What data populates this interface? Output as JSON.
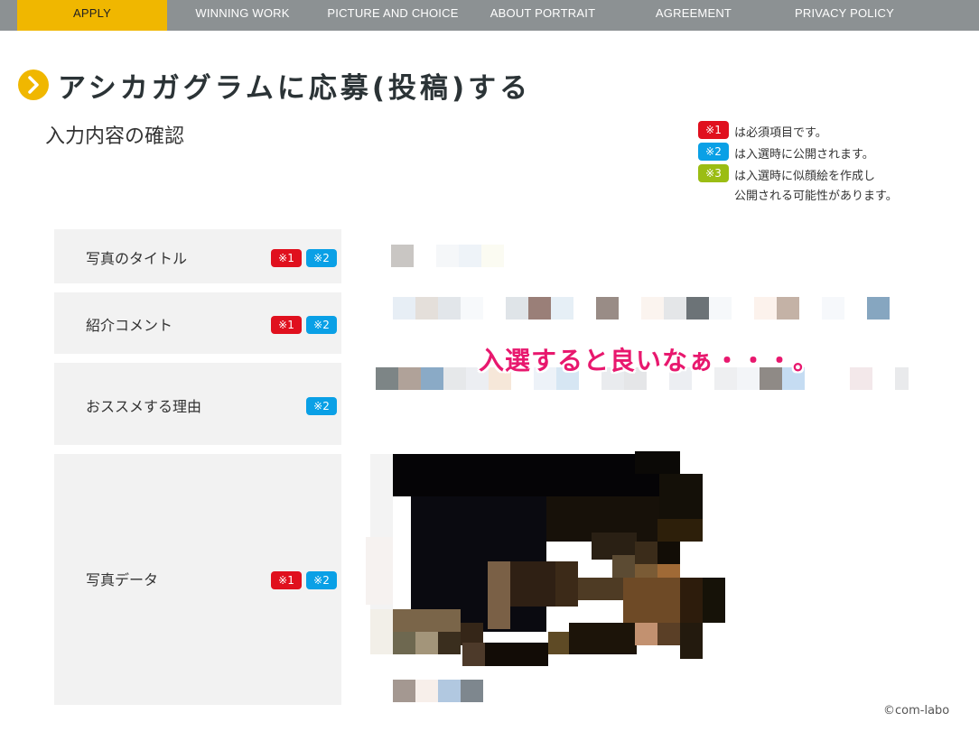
{
  "nav": {
    "items": [
      {
        "label": "APPLY"
      },
      {
        "label": "WINNING WORK"
      },
      {
        "label": "PICTURE AND CHOICE"
      },
      {
        "label": "ABOUT PORTRAIT"
      },
      {
        "label": "AGREEMENT"
      },
      {
        "label": "PRIVACY POLICY"
      }
    ]
  },
  "header": {
    "title": "アシカガグラムに応募(投稿)する",
    "subtitle": "入力内容の確認"
  },
  "legend": {
    "items": [
      {
        "badge": "※1",
        "text": "は必須項目です。"
      },
      {
        "badge": "※2",
        "text": "は入選時に公開されます。"
      },
      {
        "badge": "※3",
        "text": "は入選時に似顔絵を作成し"
      },
      {
        "text": "公開される可能性があります。"
      }
    ]
  },
  "fields": [
    {
      "label": "写真のタイトル",
      "badges": [
        "※1",
        "※2"
      ]
    },
    {
      "label": "紹介コメント",
      "badges": [
        "※1",
        "※2"
      ]
    },
    {
      "label": "おススメする理由",
      "badges": [
        "※2"
      ]
    },
    {
      "label": "写真データ",
      "badges": [
        "※1",
        "※2"
      ]
    }
  ],
  "overlay_text": "入選すると良いなぁ・・・。",
  "copyright": "©com-labo",
  "colors": {
    "accent": "#f0b700",
    "nav_bg": "#8c9193",
    "required_badge": "#e0101e",
    "public_badge": "#0aa0e6",
    "portrait_badge": "#9bbd14",
    "overlay_text": "#e8186e"
  }
}
